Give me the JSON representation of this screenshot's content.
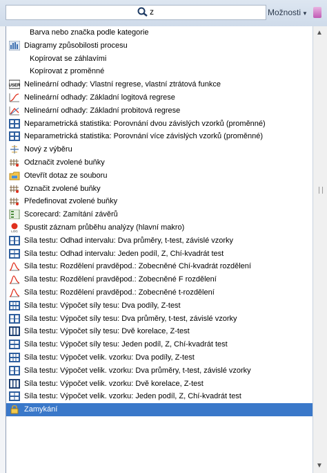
{
  "search": {
    "value": "z"
  },
  "toolbar": {
    "options_label": "Možnosti"
  },
  "items": [
    {
      "label": "Barva nebo značka podle kategorie",
      "icon": "none-icon",
      "indent": true
    },
    {
      "label": "Diagramy způsobilosti procesu",
      "icon": "process-capability-icon",
      "indent": false
    },
    {
      "label": "Kopírovat se záhlavími",
      "icon": "none-icon",
      "indent": true
    },
    {
      "label": "Kopírovat z proměnné",
      "icon": "none-icon",
      "indent": true
    },
    {
      "label": "Nelineární odhady: Vlastní regrese, vlastní ztrátová funkce",
      "icon": "user-regression-icon",
      "indent": false
    },
    {
      "label": "Nelineární odhady: Základní logitová regrese",
      "icon": "logit-curve-icon",
      "indent": false
    },
    {
      "label": "Nelineární odhady: Základní probitová regrese",
      "icon": "probit-curve-icon",
      "indent": false
    },
    {
      "label": "Neparametrická statistika: Porovnání dvou závislých vzorků (proměnné)",
      "icon": "nonparametric-grid-icon",
      "indent": false
    },
    {
      "label": "Neparametrická statistika: Porovnání více závislých vzorků (proměnné)",
      "icon": "nonparametric-grid-icon",
      "indent": false
    },
    {
      "label": "Nový z výběru",
      "icon": "new-from-selection-icon",
      "indent": false
    },
    {
      "label": "Odznačit zvolené buňky",
      "icon": "unmark-cells-icon",
      "indent": false
    },
    {
      "label": "Otevřít dotaz ze souboru",
      "icon": "open-query-icon",
      "indent": false
    },
    {
      "label": "Označit zvolené buňky",
      "icon": "mark-cells-icon",
      "indent": false
    },
    {
      "label": "Předefinovat zvolené buňky",
      "icon": "redefine-cells-icon",
      "indent": false
    },
    {
      "label": "Scorecard: Zamítání závěrů",
      "icon": "scorecard-icon",
      "indent": false
    },
    {
      "label": "Spustit záznam průběhu analýzy (hlavní makro)",
      "icon": "record-log-icon",
      "indent": false
    },
    {
      "label": "Síla testu: Odhad intervalu: Dva průměry, t-test, závislé vzorky",
      "icon": "power-two-means-icon",
      "indent": false
    },
    {
      "label": "Síla testu: Odhad intervalu: Jeden podíl, Z, Chí-kvadrát test",
      "icon": "power-one-proportion-icon",
      "indent": false
    },
    {
      "label": "Síla testu: Rozdělení pravděpod.: Zobecněné Chí-kvadrát rozdělení",
      "icon": "distribution-curve-icon",
      "indent": false
    },
    {
      "label": "Síla testu: Rozdělení pravděpod.: Zobecněné F rozdělení",
      "icon": "distribution-curve-icon",
      "indent": false
    },
    {
      "label": "Síla testu: Rozdělení pravděpod.: Zobecněné t-rozdělení",
      "icon": "distribution-curve-icon",
      "indent": false
    },
    {
      "label": "Síla testu: Výpočet síly tesu: Dva podíly, Z-test",
      "icon": "power-two-proportions-icon",
      "indent": false
    },
    {
      "label": "Síla testu: Výpočet síly tesu: Dva průměry, t-test, závislé vzorky",
      "icon": "power-two-means-icon",
      "indent": false
    },
    {
      "label": "Síla testu: Výpočet síly tesu: Dvě korelace, Z-test",
      "icon": "power-correlations-icon",
      "indent": false
    },
    {
      "label": "Síla testu: Výpočet síly tesu: Jeden podíl, Z, Chí-kvadrát test",
      "icon": "power-one-proportion-icon",
      "indent": false
    },
    {
      "label": "Síla testu: Výpočet velik. vzorku: Dva podíly, Z-test",
      "icon": "power-two-proportions-icon",
      "indent": false
    },
    {
      "label": "Síla testu: Výpočet velik. vzorku: Dva průměry, t-test, závislé vzorky",
      "icon": "power-two-means-icon",
      "indent": false
    },
    {
      "label": "Síla testu: Výpočet velik. vzorku: Dvě korelace, Z-test",
      "icon": "power-correlations-icon",
      "indent": false
    },
    {
      "label": "Síla testu: Výpočet velik. vzorku: Jeden podíl, Z, Chí-kvadrát test",
      "icon": "power-one-proportion-icon",
      "indent": false
    },
    {
      "label": "Zamykání",
      "icon": "lock-icon",
      "indent": false,
      "selected": true
    }
  ]
}
